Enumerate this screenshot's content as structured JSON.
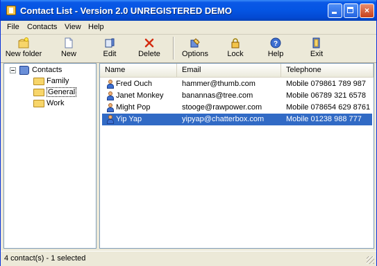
{
  "window": {
    "title": "Contact List - Version 2.0 UNREGISTERED DEMO",
    "controls": {
      "minimize": "minimize",
      "maximize": "maximize",
      "close": "×"
    }
  },
  "menu": [
    "File",
    "Contacts",
    "View",
    "Help"
  ],
  "toolbar": {
    "new_folder": "New folder",
    "new": "New",
    "edit": "Edit",
    "delete": "Delete",
    "options": "Options",
    "lock": "Lock",
    "help": "Help",
    "exit": "Exit"
  },
  "tree": {
    "root": "Contacts",
    "folders": [
      "Family",
      "General",
      "Work"
    ],
    "selected": "General"
  },
  "list": {
    "columns": [
      "Name",
      "Email",
      "Telephone"
    ],
    "rows": [
      {
        "name": "Fred Ouch",
        "email": "hammer@thumb.com",
        "phone": "Mobile 079861 789 987"
      },
      {
        "name": "Janet Monkey",
        "email": "banannas@tree.com",
        "phone": "Mobile 06789 321 6578"
      },
      {
        "name": "Might Pop",
        "email": "stooge@rawpower.com",
        "phone": "Mobile 078654 629 8761"
      },
      {
        "name": "Yip Yap",
        "email": "yipyap@chatterbox.com",
        "phone": "Mobile 01238 988 777"
      }
    ],
    "selected_row": 3
  },
  "status": {
    "text": "4 contact(s) - 1 selected"
  },
  "colors": {
    "titlebar": "#0455e3",
    "selection": "#316ac5",
    "chrome": "#ece9d8"
  }
}
